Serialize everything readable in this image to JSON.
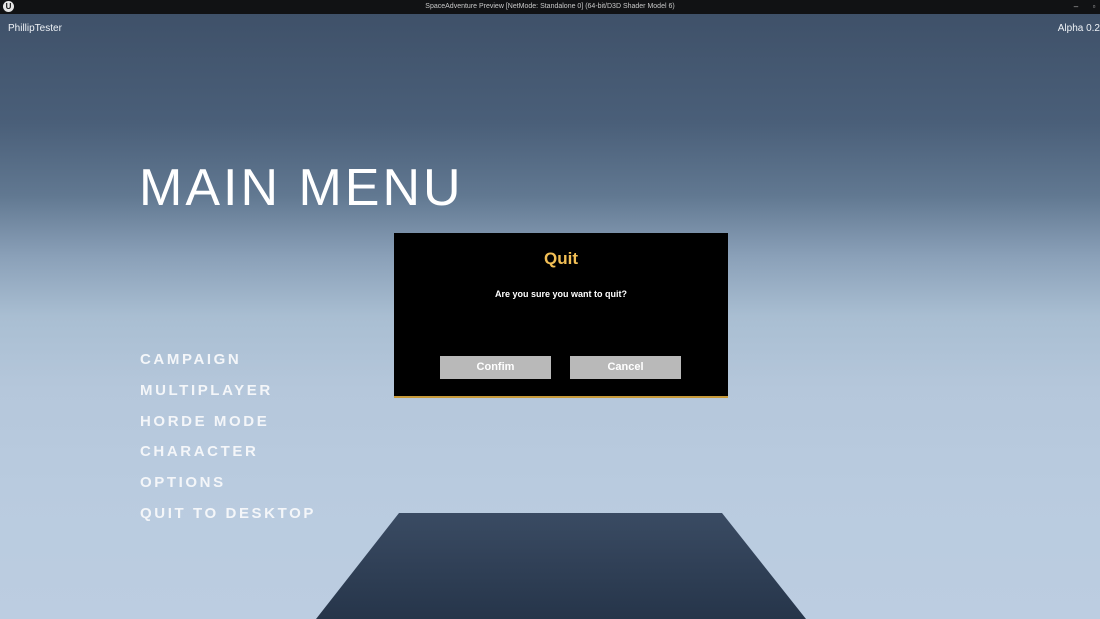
{
  "window": {
    "app_icon": "unreal-engine-logo-icon",
    "title": "SpaceAdventure Preview [NetMode: Standalone 0]  (64-bit/D3D Shader Model 6)",
    "minimize_glyph": "–",
    "maximize_glyph": "▫"
  },
  "hud": {
    "player_name": "PhillipTester",
    "version": "Alpha 0.2"
  },
  "main_menu": {
    "title": "MAIN MENU",
    "items": [
      {
        "label": "CAMPAIGN"
      },
      {
        "label": "MULTIPLAYER"
      },
      {
        "label": "HORDE MODE"
      },
      {
        "label": "CHARACTER"
      },
      {
        "label": "OPTIONS"
      },
      {
        "label": "QUIT TO DESKTOP"
      }
    ]
  },
  "quit_dialog": {
    "title": "Quit",
    "message": "Are you sure you want to quit?",
    "confirm_label": "Confim",
    "cancel_label": "Cancel"
  },
  "colors": {
    "dialog_title": "#f2bf55",
    "dialog_accent": "#c79a3a",
    "dialog_background": "#000000",
    "button_background": "#b9b9b9",
    "floor": "#2d3e55"
  }
}
